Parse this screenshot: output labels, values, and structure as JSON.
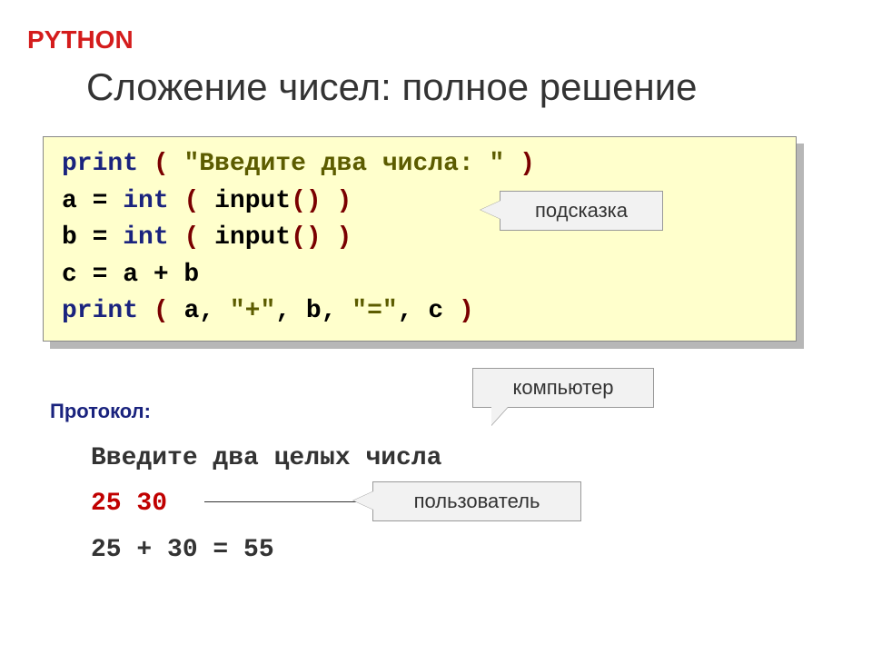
{
  "header": {
    "lang": "PYTHON",
    "title": "Сложение чисел: полное решение"
  },
  "code": {
    "l1a": "print",
    "l1b": "(",
    "l1c": " \"Введите два числа: \" ",
    "l1d": ")",
    "l2a": "a",
    "l2b": " = ",
    "l2c": "int",
    "l2d": "(",
    "l2e": " input",
    "l2f": "()",
    "l2g": " )",
    "l3a": "b",
    "l3b": " = ",
    "l3c": "int",
    "l3d": "(",
    "l3e": " input",
    "l3f": "()",
    "l3g": " )",
    "l4": "c = a + b",
    "l5a": "print",
    "l5b": "(",
    "l5c": " a, ",
    "l5d": "\"+\"",
    "l5e": ", b, ",
    "l5f": "\"=\"",
    "l5g": ", c ",
    "l5h": ")"
  },
  "callouts": {
    "hint": "подсказка",
    "computer": "компьютер",
    "user": "пользователь"
  },
  "protocol": {
    "label": "Протокол:",
    "prompt": "Введите два целых числа",
    "input": "25 30",
    "result": "25 + 30 = 55"
  }
}
